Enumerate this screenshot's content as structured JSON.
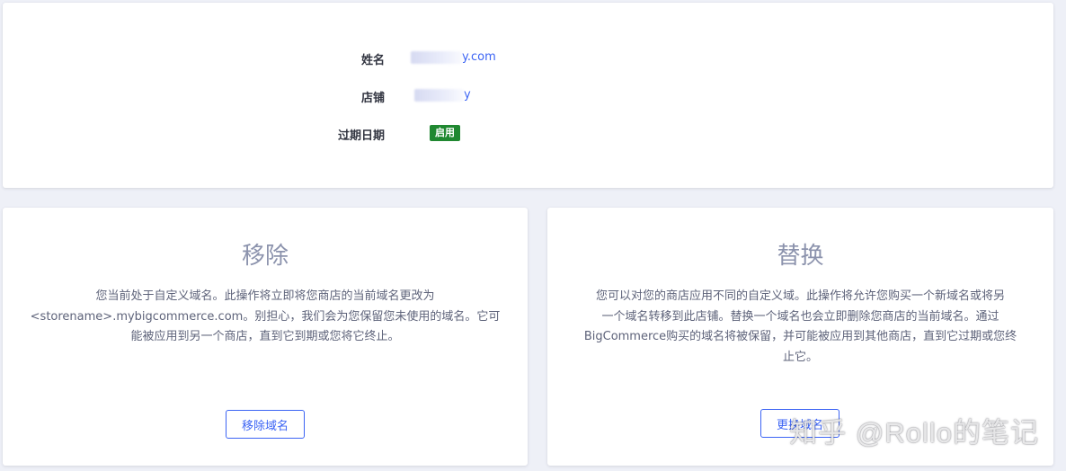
{
  "info": {
    "name_label": "姓名",
    "name_value_suffix": "y.com",
    "store_label": "店铺",
    "store_value_suffix": "y",
    "expiry_label": "过期日期",
    "status_badge": "启用"
  },
  "remove": {
    "title": "移除",
    "description_lines": [
      "您当前处于自定义域名。此操作将立即将您商店的当前域名更改为",
      "<storename>.mybigcommerce.com。别担心，我们会为您保留您未使用的域名。它可",
      "能被应用到另一个商店，直到它到期或您将它终止。"
    ],
    "button_label": "移除域名"
  },
  "replace": {
    "title": "替换",
    "description_lines": [
      "您可以对您的商店应用不同的自定义域。此操作将允许您购买一个新域名或将另",
      "一个域名转移到此店铺。替换一个域名也会立即删除您商店的当前域名。通过",
      "BigCommerce购买的域名将被保留，并可能被应用到其他商店，直到它过期或您终",
      "止它。"
    ],
    "button_label": "更换域名"
  },
  "watermark": "知乎 @Rollo的笔记",
  "colors": {
    "page_bg": "#eef0f7",
    "card_bg": "#ffffff",
    "link_blue": "#3c64f4",
    "badge_green": "#208831",
    "title_gray": "#8c93ad",
    "text_gray": "#5e637a"
  }
}
